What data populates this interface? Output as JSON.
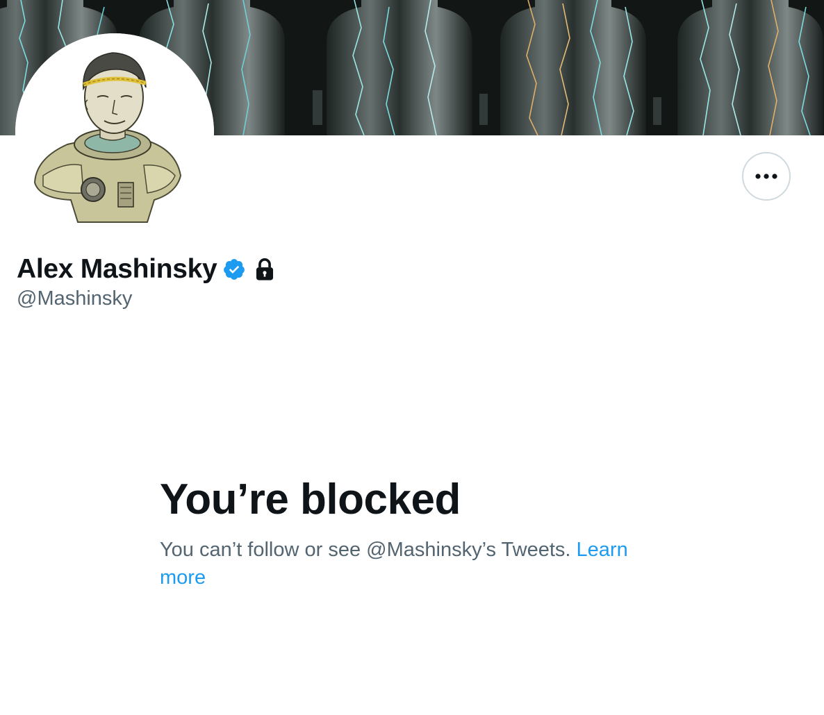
{
  "profile": {
    "display_name": "Alex Mashinsky",
    "handle": "@Mashinsky",
    "verified": true,
    "protected": true,
    "banner_description": "glass bottles with electric lightning",
    "avatar_description": "illustrated man in astronaut suit with laurel wreath"
  },
  "icons": {
    "verified": "verified-badge-icon",
    "protected": "lock-icon",
    "more": "more-dots-icon"
  },
  "blocked": {
    "title": "You’re blocked",
    "message_prefix": "You can’t follow or see @Mashinsky’s Tweets. ",
    "learn_more": "Learn more"
  },
  "colors": {
    "accent": "#1d9bf0",
    "text_primary": "#0f1419",
    "text_secondary": "#536471",
    "border": "#cfd9de"
  }
}
